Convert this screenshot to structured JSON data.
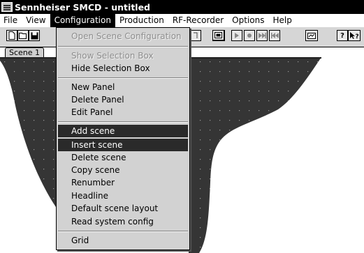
{
  "window": {
    "title": "Sennheiser SMCD - untitled"
  },
  "menubar": {
    "items": [
      "File",
      "View",
      "Configuration",
      "Production",
      "RF-Recorder",
      "Options",
      "Help"
    ],
    "active": "Configuration"
  },
  "toolbar": {
    "buttons": [
      "new-file-icon",
      "open-file-icon",
      "save-icon",
      "monitor-icon",
      "play-icon",
      "record-icon",
      "skip-forward-icon",
      "skip-back-icon",
      "window-icon",
      "help-icon",
      "context-help-icon"
    ],
    "help_label": "?",
    "context_help_label": "?"
  },
  "tabs": {
    "scene1": "Scene 1"
  },
  "dropdown": {
    "open_scene_configuration": "Open Scene Configuration",
    "show_selection_box": "Show Selection Box",
    "hide_selection_box": "Hide Selection Box",
    "new_panel": "New Panel",
    "delete_panel": "Delete Panel",
    "edit_panel": "Edit Panel",
    "add_scene": "Add scene",
    "insert_scene": "Insert scene",
    "delete_scene": "Delete scene",
    "copy_scene": "Copy scene",
    "renumber": "Renumber",
    "headline": "Headline",
    "default_scene_layout": "Default scene layout",
    "read_system_config": "Read system config",
    "grid": "Grid"
  },
  "colors": {
    "highlight": "#2a2a2a",
    "menu_bg": "#d2d2d2",
    "workspace": "#333333"
  }
}
